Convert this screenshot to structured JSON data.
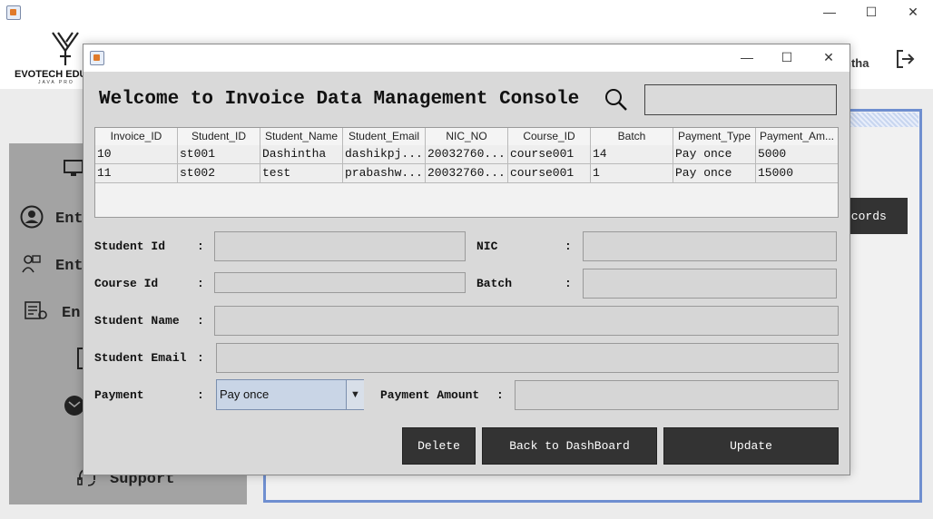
{
  "background_window": {
    "logo_text": "EVOTECH EDU",
    "logo_subtext": "JAVA PRO",
    "user_fragment": "ntha",
    "records_fragment": "ecords",
    "sidebar_fragments": [
      "Ent",
      "Ent",
      "En"
    ],
    "support_label": "Support",
    "controls": {
      "minimize": "—",
      "maximize": "☐",
      "close": "✕"
    }
  },
  "dialog": {
    "controls": {
      "minimize": "—",
      "maximize": "☐",
      "close": "✕"
    },
    "heading": "Welcome to Invoice Data Management Console",
    "search": {
      "value": "",
      "placeholder": ""
    },
    "table": {
      "columns": [
        "Invoice_ID",
        "Student_ID",
        "Student_Name",
        "Student_Email",
        "NIC_NO",
        "Course_ID",
        "Batch",
        "Payment_Type",
        "Payment_Am..."
      ],
      "rows": [
        [
          "10",
          "st001",
          "Dashintha",
          "dashikpj...",
          "20032760...",
          "course001",
          "14",
          "Pay once",
          "5000"
        ],
        [
          "11",
          "st002",
          "test",
          "prabashw...",
          "20032760...",
          "course001",
          "1",
          "Pay once",
          "15000"
        ]
      ]
    },
    "form": {
      "student_id_label": "Student Id",
      "nic_label": "NIC",
      "course_id_label": "Course Id",
      "batch_label": "Batch",
      "student_name_label": "Student Name",
      "student_email_label": "Student Email",
      "payment_label": "Payment",
      "payment_amount_label": "Payment Amount",
      "colon": ":",
      "payment_selected": "Pay once",
      "student_id_value": "",
      "nic_value": "",
      "course_id_value": "",
      "batch_value": "",
      "student_name_value": "",
      "student_email_value": "",
      "payment_amount_value": ""
    },
    "buttons": {
      "delete": "Delete",
      "back": "Back to DashBoard",
      "update": "Update"
    }
  }
}
